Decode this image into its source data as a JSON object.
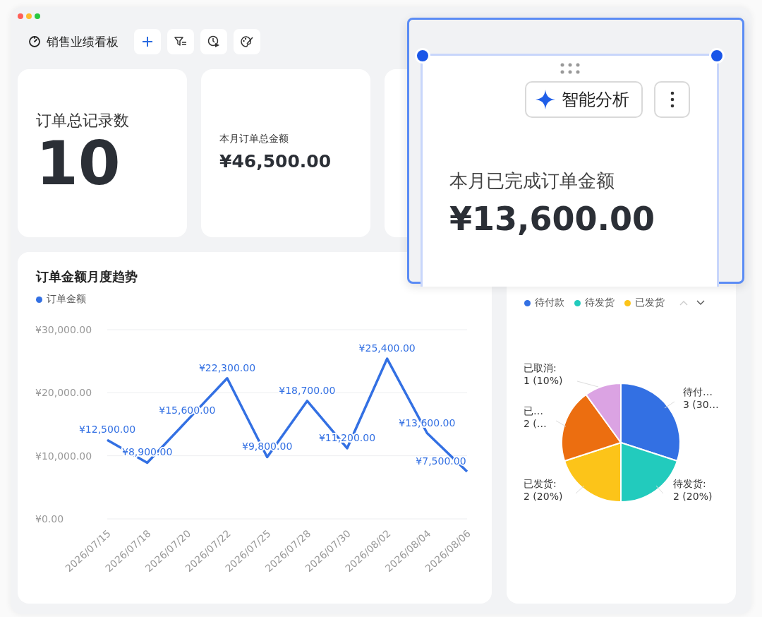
{
  "header": {
    "title": "销售业绩看板"
  },
  "cards": [
    {
      "kind": "large",
      "label": "订单总记录数",
      "value": "10"
    },
    {
      "kind": "small",
      "label": "本月订单总金额",
      "value": "¥46,500.00"
    },
    {
      "kind": "hidden"
    }
  ],
  "trend": {
    "title": "订单金额月度趋势",
    "chart_data": {
      "type": "line",
      "categories": [
        "2026/07/15",
        "2026/07/18",
        "2026/07/20",
        "2026/07/22",
        "2026/07/25",
        "2026/07/28",
        "2026/07/30",
        "2026/08/02",
        "2026/08/04",
        "2026/08/06"
      ],
      "series": [
        {
          "name": "订单金额",
          "color": "#3370e3",
          "values": [
            12500,
            8900,
            15600,
            22300,
            9800,
            18700,
            11200,
            25400,
            13600,
            7500
          ]
        }
      ],
      "ylim": [
        0,
        30000
      ],
      "yticks": [
        {
          "value": 0,
          "label": "¥0.00"
        },
        {
          "value": 10000,
          "label": "¥10,000.00"
        },
        {
          "value": 20000,
          "label": "¥20,000.00"
        },
        {
          "value": 30000,
          "label": "¥30,000.00"
        }
      ],
      "value_labels": [
        "¥12,500.00",
        "¥8,900.00",
        "¥15,600.00",
        "¥22,300.00",
        "¥9,800.00",
        "¥18,700.00",
        "¥11,200.00",
        "¥25,400.00",
        "¥13,600.00",
        "¥7,500.00"
      ]
    }
  },
  "status": {
    "legend": [
      {
        "name": "待付款",
        "color": "#3370e3"
      },
      {
        "name": "待发货",
        "color": "#22cbbd"
      },
      {
        "name": "已发货",
        "color": "#fcc419"
      }
    ],
    "chart_data": {
      "type": "pie",
      "values": [
        30,
        20,
        20,
        20,
        10
      ]
    },
    "slice_labels": [
      {
        "name": "已取消:",
        "value": "1 (10%)"
      },
      {
        "name": "待付…",
        "value": "3 (30…"
      },
      {
        "name": "已…",
        "value": "2 (…"
      },
      {
        "name": "已发货:",
        "value": "2 (20%)"
      },
      {
        "name": "待发货:",
        "value": "2 (20%)"
      }
    ]
  },
  "callout": {
    "ai_button": {
      "label": "智能分析"
    },
    "metric_label": "本月已完成订单金额",
    "metric_value": "¥13,600.00"
  }
}
